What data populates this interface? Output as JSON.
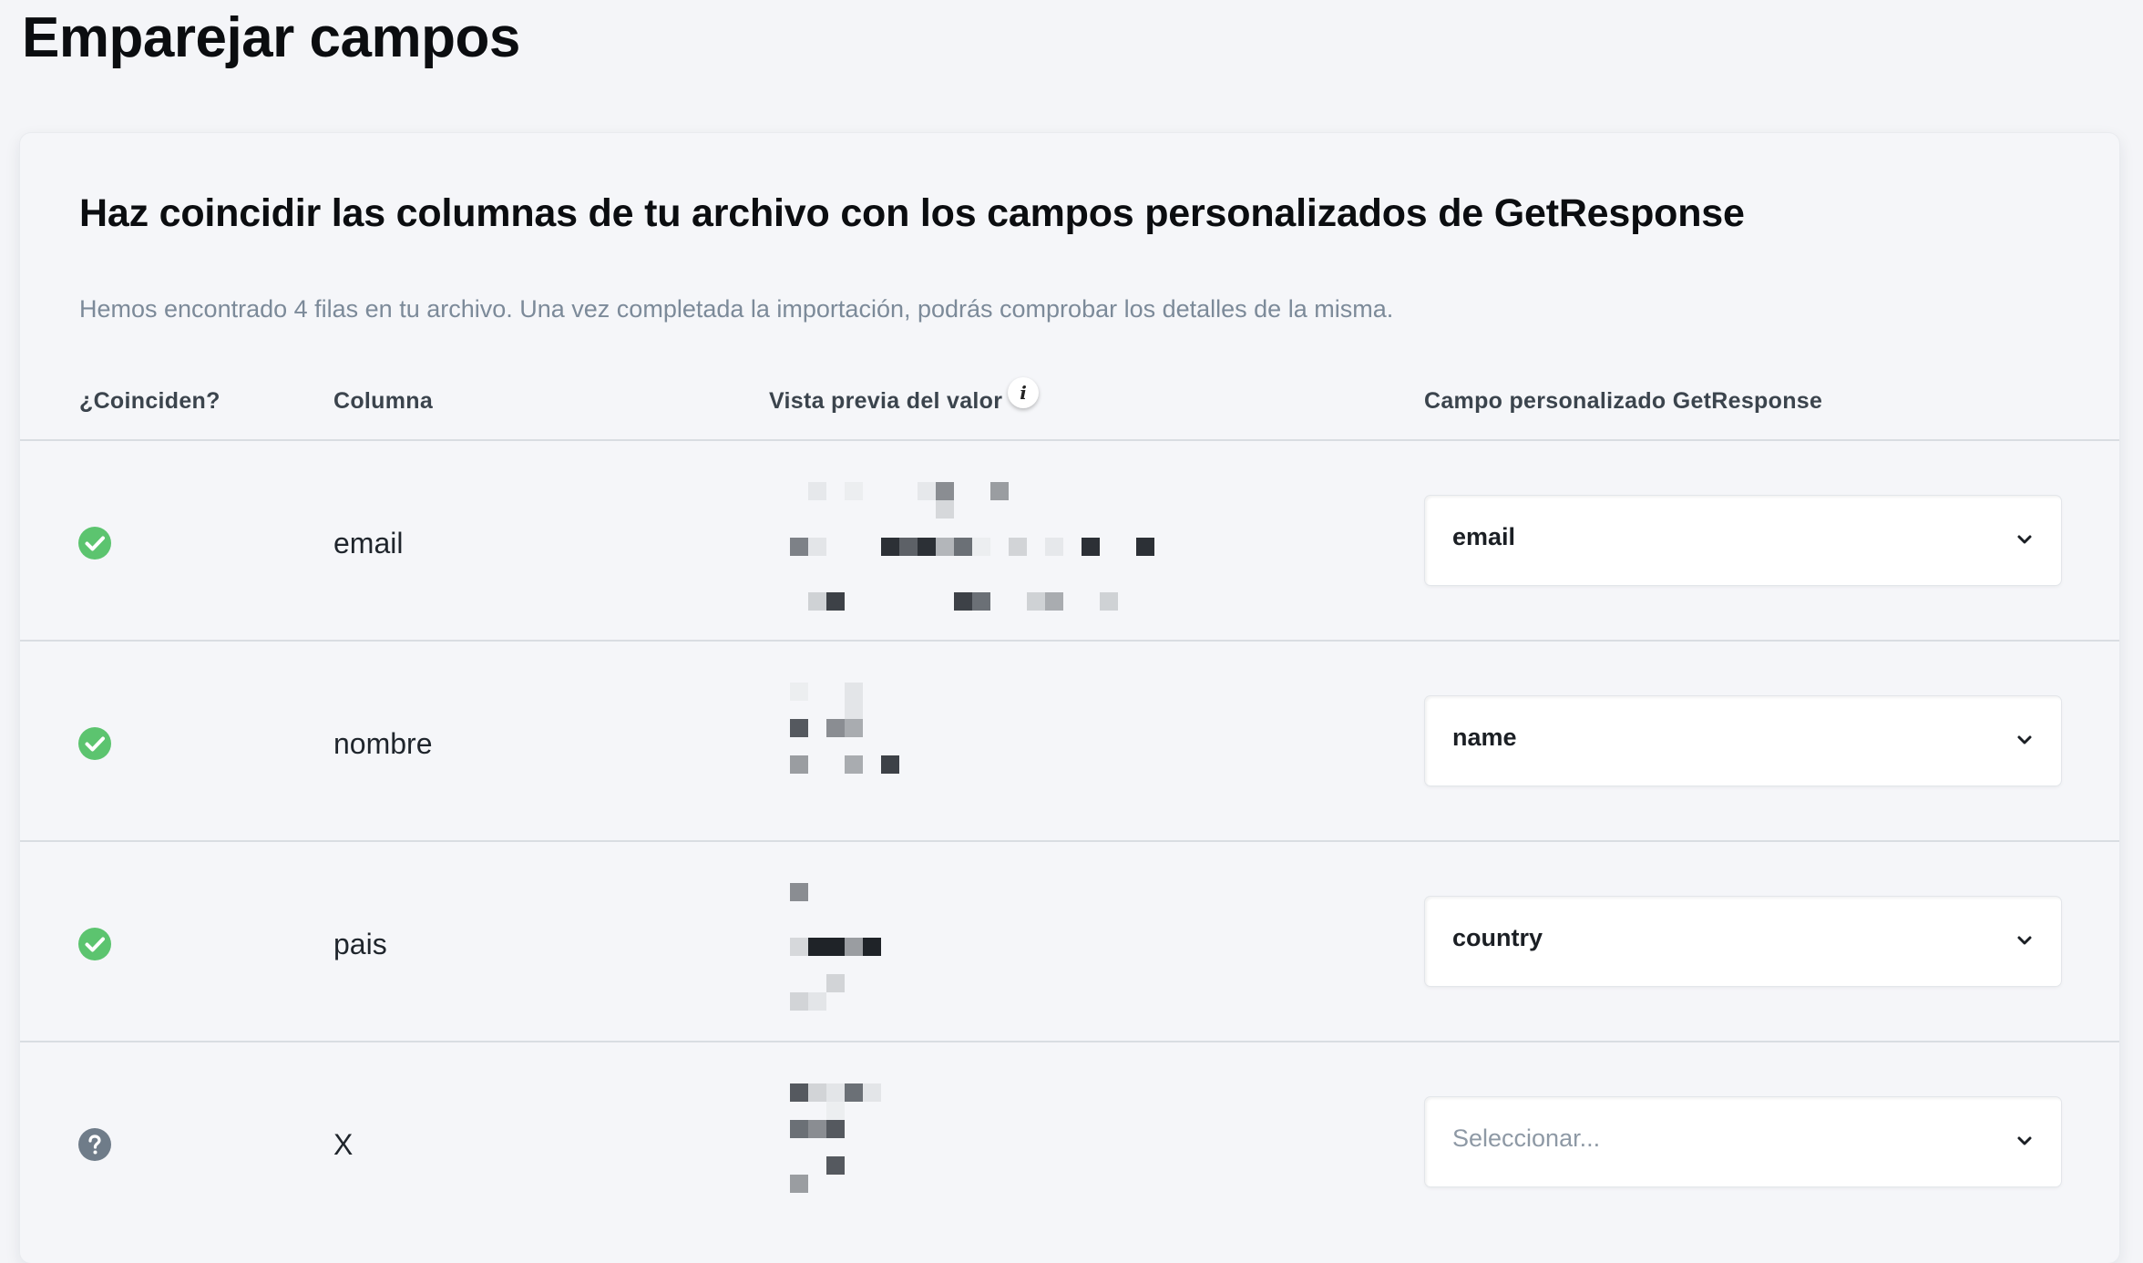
{
  "page_title": "Emparejar campos",
  "card": {
    "title": "Haz coincidir las columnas de tu archivo con los campos personalizados de GetResponse",
    "description": "Hemos encontrado 4 filas en tu archivo. Una vez completada la importación, podrás comprobar los detalles de la misma."
  },
  "table": {
    "headers": {
      "match": "¿Coinciden?",
      "column": "Columna",
      "preview": "Vista previa del valor",
      "field": "Campo personalizado GetResponse"
    },
    "info_icon": "info-icon",
    "rows": [
      {
        "matched": true,
        "status_icon": "check-circle-icon",
        "column": "email",
        "field": "email",
        "preview_note": "pixelated values"
      },
      {
        "matched": true,
        "status_icon": "check-circle-icon",
        "column": "nombre",
        "field": "name",
        "preview_note": "pixelated values"
      },
      {
        "matched": true,
        "status_icon": "check-circle-icon",
        "column": "pais",
        "field": "country",
        "preview_note": "pixelated values"
      },
      {
        "matched": false,
        "status_icon": "question-circle-icon",
        "column": "X",
        "field": "",
        "placeholder": "Seleccionar...",
        "preview_note": "pixelated values"
      }
    ]
  },
  "colors": {
    "match_green": "#5cc46f",
    "unknown_gray": "#6f7c89",
    "background": "#f4f5f8"
  }
}
